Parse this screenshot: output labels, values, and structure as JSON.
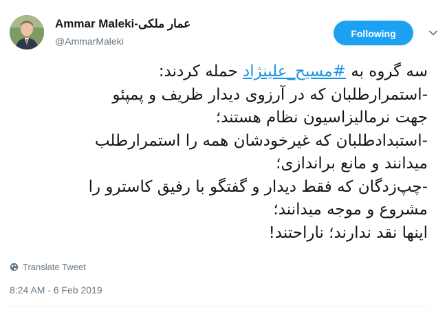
{
  "author": {
    "display_name": "Ammar Maleki-عمار ملکی",
    "handle": "@AmmarMaleki"
  },
  "follow_button": {
    "label": "Following",
    "color": "#1da1f2"
  },
  "more_menu": {
    "icon": "chevron-down-icon"
  },
  "tweet": {
    "line1_before": "سه گروه به ",
    "hashtag": "#مسیح_علینژاد",
    "line1_after": " حمله کردند:",
    "lines": [
      "-استمرارطلبان که در آرزوی دیدار ظریف و پمپئو",
      "جهت نرمالیزاسیون نظام هستند؛",
      "-استبدادطلبان که غیرخودشان همه را استمرارطلب",
      "میدانند و مانع براندازی؛",
      "-چپ‌زدگان که فقط دیدار و گفتگو با رفیق کاسترو را",
      "مشروع و موجه میدانند؛",
      "اینها نقد ندارند؛ ناراحتند!"
    ]
  },
  "translate": {
    "label": "Translate Tweet",
    "icon": "globe-icon"
  },
  "timestamp": "8:24 AM - 6 Feb 2019",
  "colors": {
    "link": "#1b95e0",
    "muted": "#657786"
  }
}
